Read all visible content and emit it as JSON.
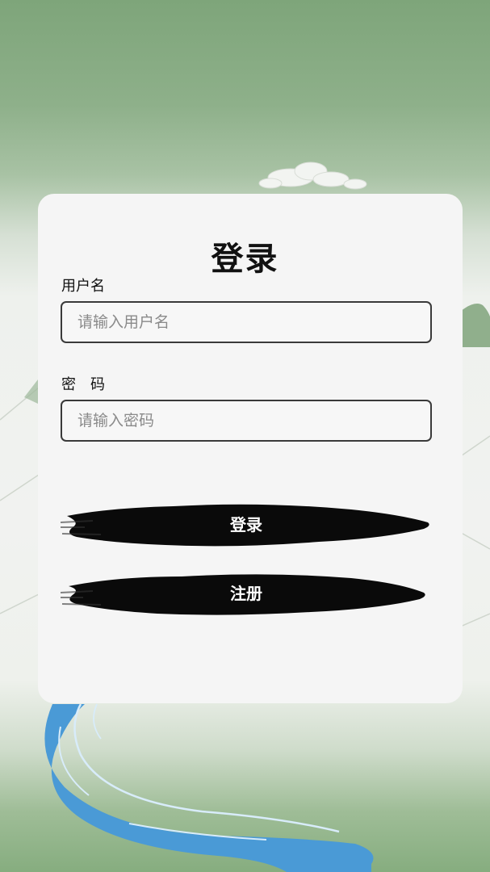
{
  "login": {
    "title": "登录",
    "username": {
      "label": "用户名",
      "placeholder": "请输入用户名",
      "value": ""
    },
    "password": {
      "label": "密　码",
      "placeholder": "请输入密码",
      "value": ""
    },
    "login_button": "登录",
    "register_button": "注册"
  },
  "colors": {
    "sky": "#7ea57a",
    "card": "#f5f5f5",
    "river": "#4a9ad6",
    "ink": "#0a0a0a"
  },
  "icons": [
    "cloud-decoration",
    "mountain-decoration",
    "river-decoration"
  ]
}
